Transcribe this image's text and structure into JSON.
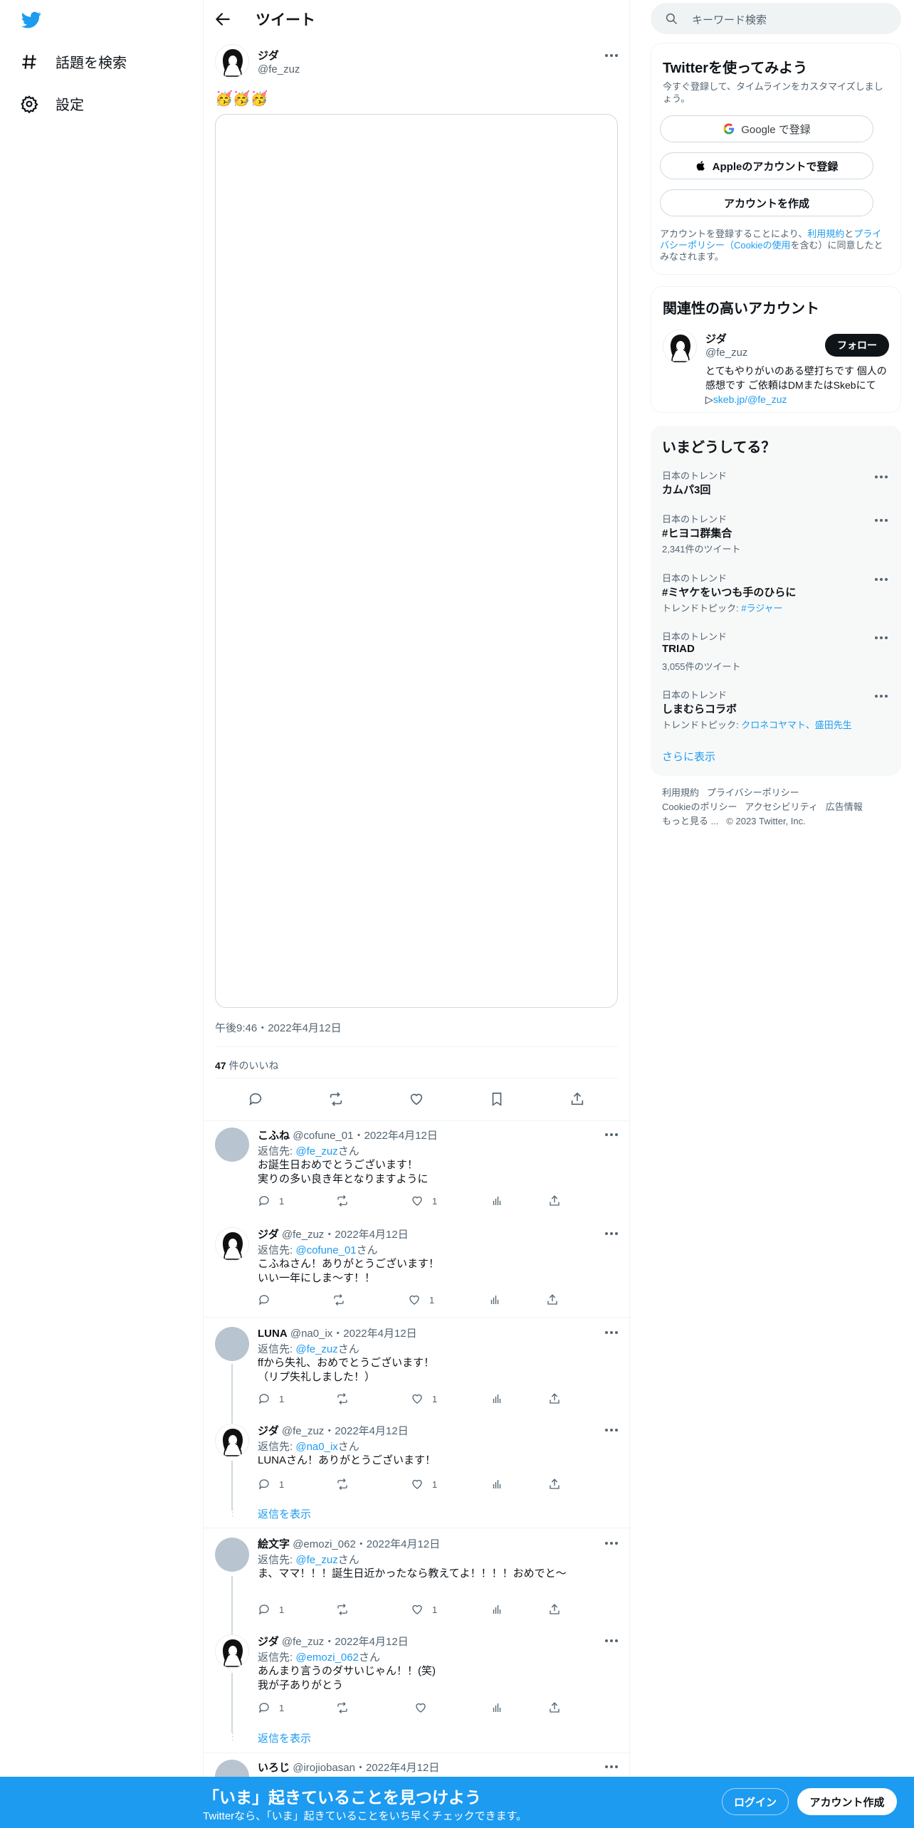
{
  "nav": {
    "explore": "話題を検索",
    "settings": "設定"
  },
  "header": {
    "title": "ツイート"
  },
  "tweet": {
    "name": "ジダ",
    "handle": "@fe_zuz",
    "text": "🥳🥳🥳",
    "time": "午後9:46・2022年4月12日",
    "likes_count": "47",
    "likes_label": "件のいいね"
  },
  "replies": [
    {
      "name": "こふね",
      "handle": "@cofune_01",
      "date": "・2022年4月12日",
      "reply_prefix": "返信先: ",
      "reply_to": "@fe_zuz",
      "reply_suffix": "さん",
      "line1": "お誕生日おめでとうございます！",
      "line2": "実りの多い良き年となりますように",
      "replies": "1",
      "retweets": "",
      "likes": "1"
    },
    {
      "name": "ジダ",
      "handle": "@fe_zuz",
      "date": "・2022年4月12日",
      "reply_prefix": "返信先: ",
      "reply_to": "@cofune_01",
      "reply_suffix": "さん",
      "line1": "こふねさん！ありがとうございます！",
      "line2": "いい一年にしま～す！！",
      "replies": "",
      "retweets": "",
      "likes": "1"
    },
    {
      "name": "LUNA",
      "handle": "@na0_ix",
      "date": "・2022年4月12日",
      "reply_prefix": "返信先: ",
      "reply_to": "@fe_zuz",
      "reply_suffix": "さん",
      "line1": "ffから失礼、おめでとうございます！",
      "line2": "（リプ失礼しました！）",
      "replies": "1",
      "retweets": "",
      "likes": "1"
    },
    {
      "name": "ジダ",
      "handle": "@fe_zuz",
      "date": "・2022年4月12日",
      "reply_prefix": "返信先: ",
      "reply_to": "@na0_ix",
      "reply_suffix": "さん",
      "line1": "LUNAさん！ありがとうございます！",
      "line2": "",
      "replies": "1",
      "retweets": "",
      "likes": "1"
    },
    {
      "name": "絵文字",
      "handle": "@emozi_062",
      "date": "・2022年4月12日",
      "reply_prefix": "返信先: ",
      "reply_to": "@fe_zuz",
      "reply_suffix": "さん",
      "line1": "ま、ママ！！！誕生日近かったなら教えてよ！！！！おめでと〜",
      "line2": "",
      "replies": "1",
      "retweets": "",
      "likes": "1"
    },
    {
      "name": "ジダ",
      "handle": "@fe_zuz",
      "date": "・2022年4月12日",
      "reply_prefix": "返信先: ",
      "reply_to": "@emozi_062",
      "reply_suffix": "さん",
      "line1": "あんまり言うのダサいじゃん！！(笑)",
      "line2": "我が子ありがとう",
      "replies": "1",
      "retweets": "",
      "likes": ""
    },
    {
      "name": "いろじ",
      "handle": "@irojiobasan",
      "date": "・2022年4月12日"
    }
  ],
  "show_replies": "返信を表示",
  "search": {
    "placeholder": "キーワード検索"
  },
  "signup_card": {
    "title": "Twitterを使ってみよう",
    "subtitle": "今すぐ登録して、タイムラインをカスタマイズしましょう。",
    "google": "Google で登録",
    "apple": "Appleのアカウントで登録",
    "create": "アカウントを作成",
    "legal_1": "アカウントを登録することにより、",
    "legal_terms": "利用規約",
    "legal_and": "と",
    "legal_privacy": "プライバシーポリシー（Cookieの使用",
    "legal_2": "を含む）に同意したとみなされます。"
  },
  "related": {
    "title": "関連性の高いアカウント",
    "name": "ジダ",
    "handle": "@fe_zuz",
    "follow": "フォロー",
    "bio": "とてもやりがいのある壁打ちです 個人の感想です ご依頼はDMまたはSkebにて▷",
    "bio_link": "skeb.jp/@fe_zuz"
  },
  "trends": {
    "title": "いまどうしてる？",
    "items": [
      {
        "category": "日本のトレンド",
        "title": "カムパ3回",
        "count": "",
        "topic_prefix": "",
        "topic": ""
      },
      {
        "category": "日本のトレンド",
        "title": "#ヒヨコ群集合",
        "count": "2,341件のツイート",
        "topic_prefix": "",
        "topic": ""
      },
      {
        "category": "日本のトレンド",
        "title": "#ミヤケをいつも手のひらに",
        "count": "",
        "topic_prefix": "トレンドトピック: ",
        "topic": "#ラジャー"
      },
      {
        "category": "日本のトレンド",
        "title": "TRIAD",
        "count": "3,055件のツイート",
        "topic_prefix": "",
        "topic": ""
      },
      {
        "category": "日本のトレンド",
        "title": "しまむらコラボ",
        "count": "",
        "topic_prefix": "トレンドトピック: ",
        "topic": "クロネコヤマト、盛田先生"
      }
    ],
    "show_more": "さらに表示"
  },
  "footer": {
    "terms": "利用規約",
    "privacy": "プライバシーポリシー",
    "cookie": "Cookieのポリシー",
    "accessibility": "アクセシビリティ",
    "ads": "広告情報",
    "more": "もっと見る ...",
    "copyright": "© 2023 Twitter, Inc."
  },
  "bottom_bar": {
    "headline": "「いま」起きていることを見つけよう",
    "sub": "Twitterなら、「いま」起きていることをいち早くチェックできます。",
    "login": "ログイン",
    "signup": "アカウント作成"
  },
  "colors": {
    "accent": "#1d9bf0",
    "text": "#0f1419",
    "secondary": "#536471"
  }
}
